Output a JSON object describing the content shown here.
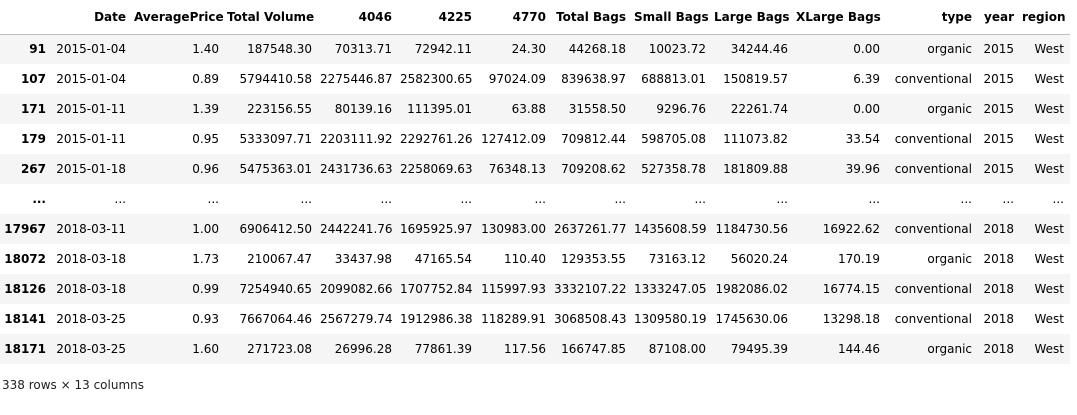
{
  "table": {
    "index_header": "",
    "columns": [
      "Date",
      "AveragePrice",
      "Total Volume",
      "4046",
      "4225",
      "4770",
      "Total Bags",
      "Small Bags",
      "Large Bags",
      "XLarge Bags",
      "type",
      "year",
      "region"
    ],
    "rows": [
      {
        "index": "91",
        "cells": [
          "2015-01-04",
          "1.40",
          "187548.30",
          "70313.71",
          "72942.11",
          "24.30",
          "44268.18",
          "10023.72",
          "34244.46",
          "0.00",
          "organic",
          "2015",
          "West"
        ]
      },
      {
        "index": "107",
        "cells": [
          "2015-01-04",
          "0.89",
          "5794410.58",
          "2275446.87",
          "2582300.65",
          "97024.09",
          "839638.97",
          "688813.01",
          "150819.57",
          "6.39",
          "conventional",
          "2015",
          "West"
        ]
      },
      {
        "index": "171",
        "cells": [
          "2015-01-11",
          "1.39",
          "223156.55",
          "80139.16",
          "111395.01",
          "63.88",
          "31558.50",
          "9296.76",
          "22261.74",
          "0.00",
          "organic",
          "2015",
          "West"
        ]
      },
      {
        "index": "179",
        "cells": [
          "2015-01-11",
          "0.95",
          "5333097.71",
          "2203111.92",
          "2292761.26",
          "127412.09",
          "709812.44",
          "598705.08",
          "111073.82",
          "33.54",
          "conventional",
          "2015",
          "West"
        ]
      },
      {
        "index": "267",
        "cells": [
          "2015-01-18",
          "0.96",
          "5475363.01",
          "2431736.63",
          "2258069.63",
          "76348.13",
          "709208.62",
          "527358.78",
          "181809.88",
          "39.96",
          "conventional",
          "2015",
          "West"
        ]
      },
      {
        "index": "...",
        "cells": [
          "...",
          "...",
          "...",
          "...",
          "...",
          "...",
          "...",
          "...",
          "...",
          "...",
          "...",
          "...",
          "..."
        ]
      },
      {
        "index": "17967",
        "cells": [
          "2018-03-11",
          "1.00",
          "6906412.50",
          "2442241.76",
          "1695925.97",
          "130983.00",
          "2637261.77",
          "1435608.59",
          "1184730.56",
          "16922.62",
          "conventional",
          "2018",
          "West"
        ]
      },
      {
        "index": "18072",
        "cells": [
          "2018-03-18",
          "1.73",
          "210067.47",
          "33437.98",
          "47165.54",
          "110.40",
          "129353.55",
          "73163.12",
          "56020.24",
          "170.19",
          "organic",
          "2018",
          "West"
        ]
      },
      {
        "index": "18126",
        "cells": [
          "2018-03-18",
          "0.99",
          "7254940.65",
          "2099082.66",
          "1707752.84",
          "115997.93",
          "3332107.22",
          "1333247.05",
          "1982086.02",
          "16774.15",
          "conventional",
          "2018",
          "West"
        ]
      },
      {
        "index": "18141",
        "cells": [
          "2018-03-25",
          "0.93",
          "7667064.46",
          "2567279.74",
          "1912986.38",
          "118289.91",
          "3068508.43",
          "1309580.19",
          "1745630.06",
          "13298.18",
          "conventional",
          "2018",
          "West"
        ]
      },
      {
        "index": "18171",
        "cells": [
          "2018-03-25",
          "1.60",
          "271723.08",
          "26996.28",
          "77861.39",
          "117.56",
          "166747.85",
          "87108.00",
          "79495.39",
          "144.46",
          "organic",
          "2018",
          "West"
        ]
      }
    ]
  },
  "shape_text": "338 rows × 13 columns"
}
